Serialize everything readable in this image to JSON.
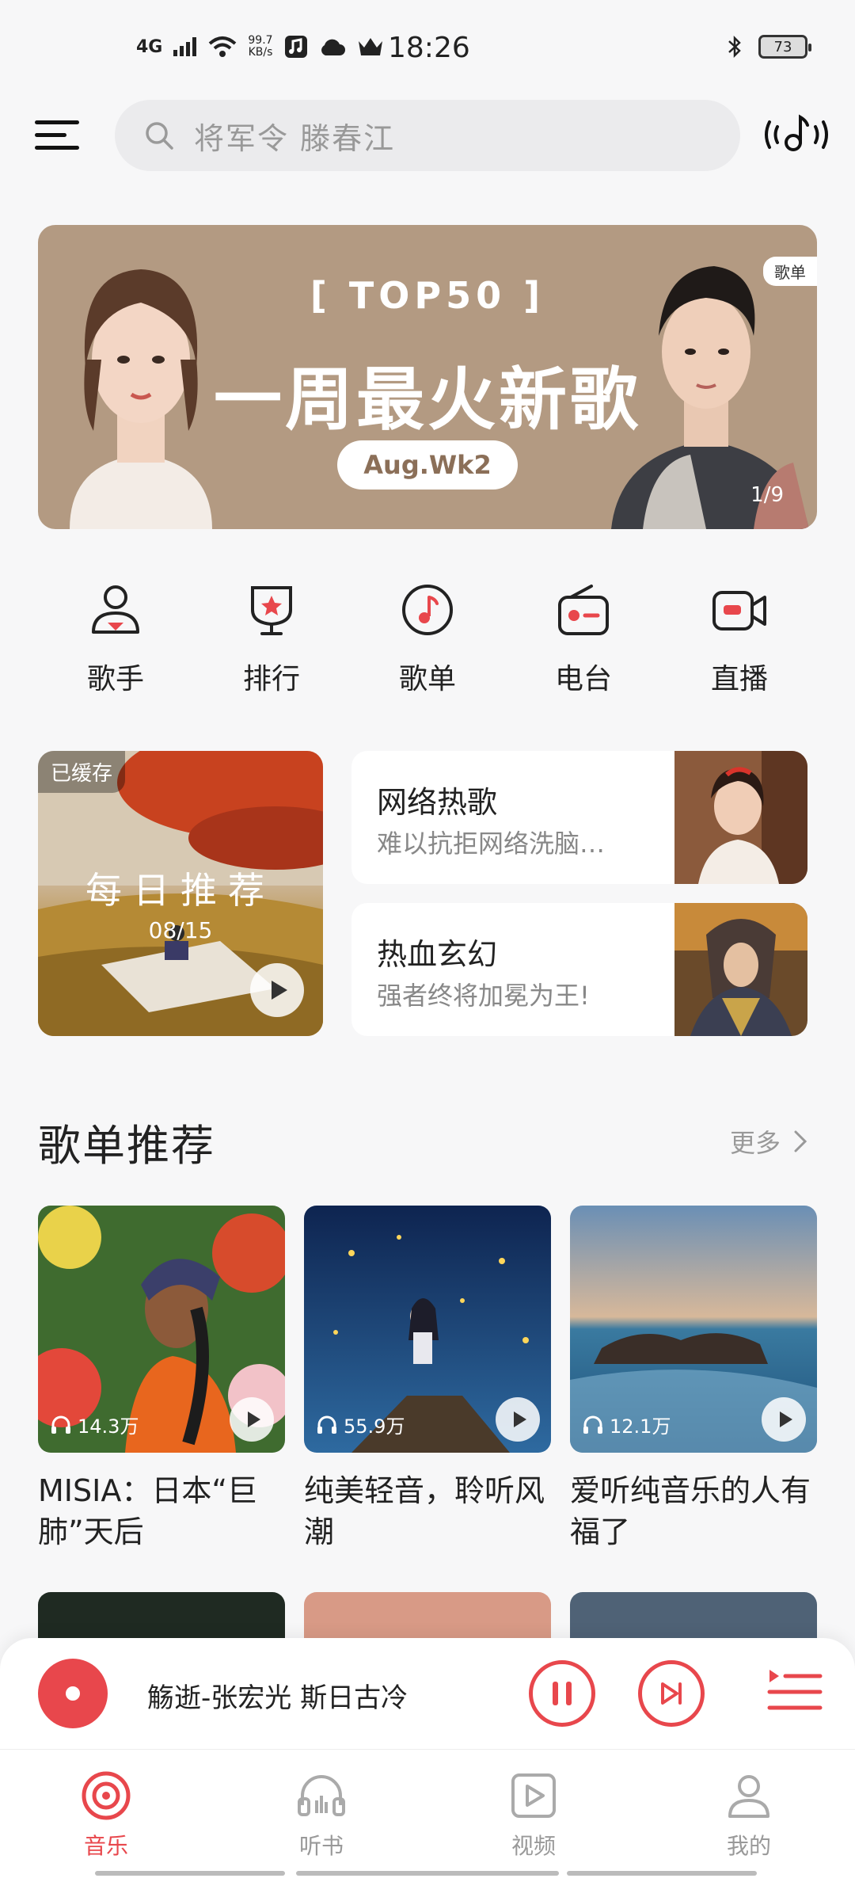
{
  "status_bar": {
    "network": "4G",
    "net_speed_value": "99.7",
    "net_speed_unit": "KB/s",
    "time": "18:26",
    "battery": "73",
    "icons": [
      "signal-icon",
      "wifi-icon",
      "music-notify-icon",
      "cloud-icon",
      "crown-icon",
      "bluetooth-icon",
      "battery-icon"
    ]
  },
  "search": {
    "placeholder": "将军令 滕春江"
  },
  "banner": {
    "top_text": "[ TOP50 ]",
    "title": "一周最火新歌",
    "week": "Aug.Wk2",
    "tag": "歌单",
    "page": "1/9"
  },
  "quick_entries": [
    {
      "label": "歌手",
      "icon": "singer-icon"
    },
    {
      "label": "排行",
      "icon": "chart-rank-icon"
    },
    {
      "label": "歌单",
      "icon": "playlist-icon"
    },
    {
      "label": "电台",
      "icon": "radio-icon"
    },
    {
      "label": "直播",
      "icon": "live-video-icon"
    }
  ],
  "daily": {
    "badge": "已缓存",
    "title": "每日推荐",
    "date": "08/15"
  },
  "cards": [
    {
      "title": "网络热歌",
      "subtitle": "难以抗拒网络洗脑…"
    },
    {
      "title": "热血玄幻",
      "subtitle": "强者终将加冕为王!"
    }
  ],
  "section": {
    "title": "歌单推荐",
    "more": "更多"
  },
  "playlists": [
    {
      "count": "14.3万",
      "name": "MISIA：日本“巨肺”天后"
    },
    {
      "count": "55.9万",
      "name": "纯美轻音，聆听风潮"
    },
    {
      "count": "12.1万",
      "name": "爱听纯音乐的人有福了"
    }
  ],
  "player": {
    "now_playing": "觞逝-张宏光 斯日古冷"
  },
  "nav": [
    {
      "label": "音乐",
      "icon": "music-disc-icon",
      "active": true
    },
    {
      "label": "听书",
      "icon": "headphones-icon",
      "active": false
    },
    {
      "label": "视频",
      "icon": "video-play-icon",
      "active": false
    },
    {
      "label": "我的",
      "icon": "profile-icon",
      "active": false
    }
  ],
  "colors": {
    "accent": "#e8474c",
    "background": "#f7f7f8",
    "banner": "#b39a82"
  }
}
